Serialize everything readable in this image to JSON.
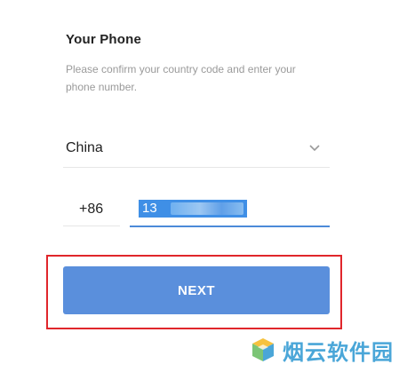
{
  "header": {
    "title": "Your Phone",
    "subtitle": "Please confirm your country code and enter your phone number."
  },
  "country_select": {
    "selected": "China",
    "icon": "chevron-down-icon"
  },
  "phone_form": {
    "country_code": "+86",
    "phone_value": "13"
  },
  "actions": {
    "next_label": "NEXT"
  },
  "watermark": {
    "text": "烟云软件园"
  },
  "colors": {
    "button": "#5a8fdc",
    "input_focus": "#4c8ad9",
    "highlight": "#e0262b",
    "selection": "#3f8fe6"
  }
}
